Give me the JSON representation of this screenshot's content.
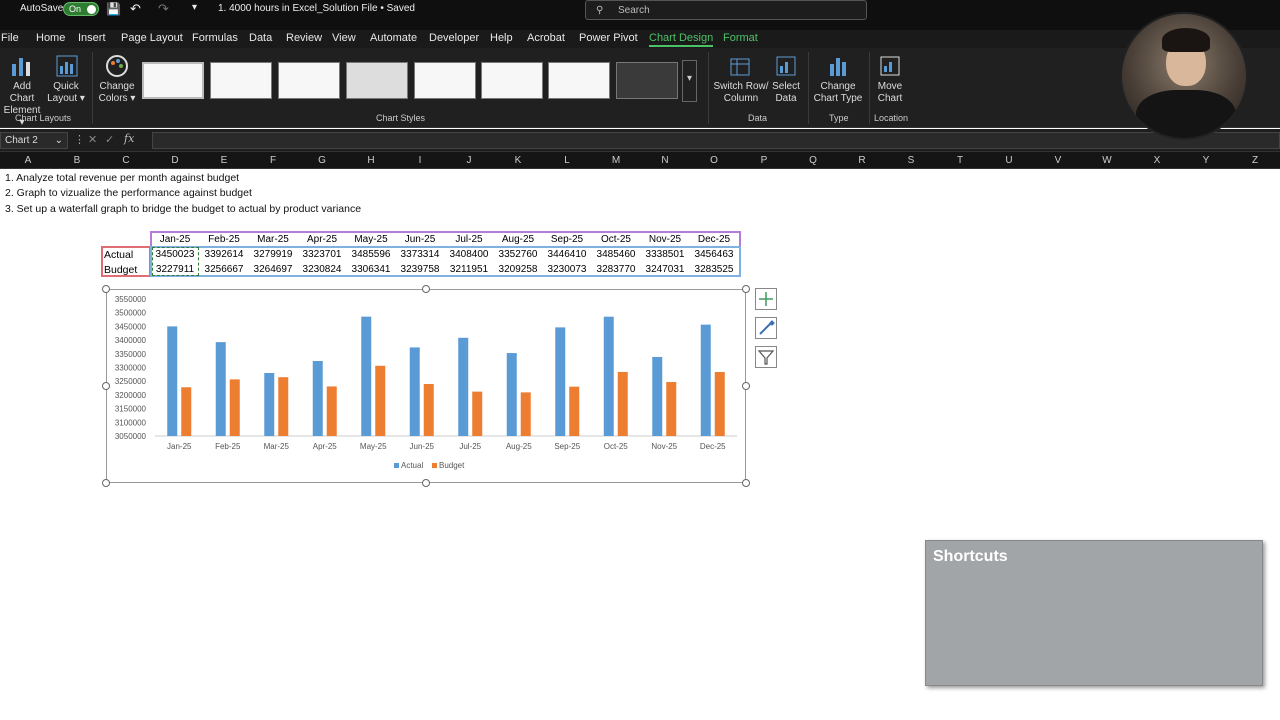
{
  "titlebar": {
    "autosave": "AutoSave",
    "autosave_state": "On",
    "file_title": "1. 4000 hours in Excel_Solution File • Saved",
    "search_placeholder": "Search"
  },
  "menu": [
    "File",
    "Home",
    "Insert",
    "Page Layout",
    "Formulas",
    "Data",
    "Review",
    "View",
    "Automate",
    "Developer",
    "Help",
    "Acrobat",
    "Power Pivot",
    "Chart Design",
    "Format"
  ],
  "ribbon": {
    "add_chart": [
      "Add Chart",
      "Element"
    ],
    "quick_layout": [
      "Quick",
      "Layout"
    ],
    "change_colors": [
      "Change",
      "Colors"
    ],
    "group_chart_layouts": "Chart Layouts",
    "group_chart_styles": "Chart Styles",
    "switch_row": [
      "Switch Row/",
      "Column"
    ],
    "select_data": [
      "Select",
      "Data"
    ],
    "group_data": "Data",
    "change_type": [
      "Change",
      "Chart Type"
    ],
    "group_type": "Type",
    "move_chart": [
      "Move",
      "Chart"
    ],
    "group_location": "Location"
  },
  "formula_bar": {
    "name_box": "Chart 2",
    "fx": "fx"
  },
  "columns": [
    "A",
    "B",
    "C",
    "D",
    "E",
    "F",
    "G",
    "H",
    "I",
    "J",
    "K",
    "L",
    "M",
    "N",
    "O",
    "P",
    "Q",
    "R",
    "S",
    "T",
    "U",
    "V",
    "W",
    "X",
    "Y",
    "Z"
  ],
  "notes": [
    "1. Analyze total revenue per month against budget",
    "2. Graph to vizualize the performance against budget",
    "3. Set up a waterfall graph to bridge the budget to actual by product variance"
  ],
  "table": {
    "months": [
      "Jan-25",
      "Feb-25",
      "Mar-25",
      "Apr-25",
      "May-25",
      "Jun-25",
      "Jul-25",
      "Aug-25",
      "Sep-25",
      "Oct-25",
      "Nov-25",
      "Dec-25"
    ],
    "actual_label": "Actual",
    "budget_label": "Budget",
    "actual": [
      "3450023",
      "3392614",
      "3279919",
      "3323701",
      "3485596",
      "3373314",
      "3408400",
      "3352760",
      "3446410",
      "3485460",
      "3338501",
      "3456463"
    ],
    "budget": [
      "3227911",
      "3256667",
      "3264697",
      "3230824",
      "3306341",
      "3239758",
      "3211951",
      "3209258",
      "3230073",
      "3283770",
      "3247031",
      "3283525"
    ]
  },
  "chart_data": {
    "type": "bar",
    "categories": [
      "Jan-25",
      "Feb-25",
      "Mar-25",
      "Apr-25",
      "May-25",
      "Jun-25",
      "Jul-25",
      "Aug-25",
      "Sep-25",
      "Oct-25",
      "Nov-25",
      "Dec-25"
    ],
    "series": [
      {
        "name": "Actual",
        "color": "#5b9bd5",
        "values": [
          3450023,
          3392614,
          3279919,
          3323701,
          3485596,
          3373314,
          3408400,
          3352760,
          3446410,
          3485460,
          3338501,
          3456463
        ]
      },
      {
        "name": "Budget",
        "color": "#ed7d31",
        "values": [
          3227911,
          3256667,
          3264697,
          3230824,
          3306341,
          3239758,
          3211951,
          3209258,
          3230073,
          3283770,
          3247031,
          3283525
        ]
      }
    ],
    "ylim": [
      3050000,
      3550000
    ],
    "yticks": [
      "3550000",
      "3500000",
      "3450000",
      "3400000",
      "3350000",
      "3300000",
      "3250000",
      "3200000",
      "3150000",
      "3100000",
      "3050000"
    ],
    "legend": "bottom",
    "grid": false
  },
  "shortcuts_title": "Shortcuts"
}
